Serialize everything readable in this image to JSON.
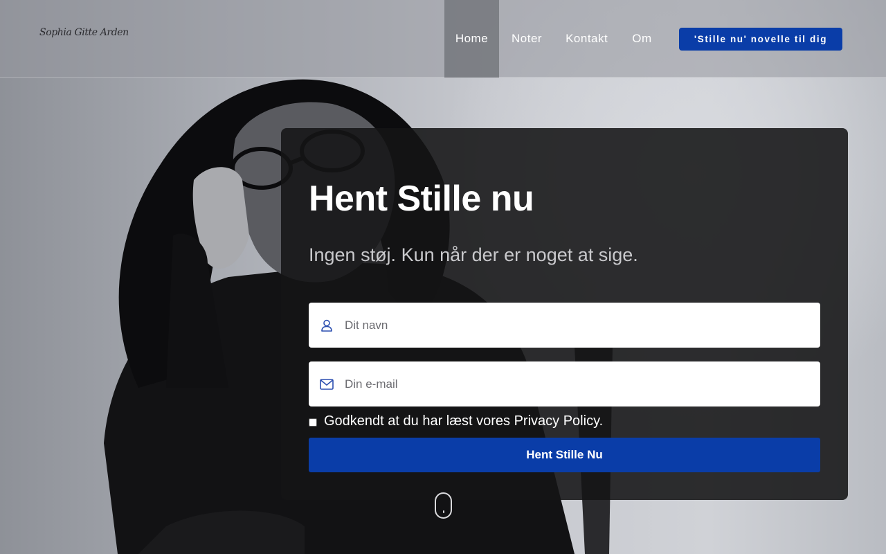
{
  "brand": {
    "logo_text": "Sophia Gitte Arden"
  },
  "nav": {
    "items": [
      {
        "label": "Home",
        "active": true
      },
      {
        "label": "Noter",
        "active": false
      },
      {
        "label": "Kontakt",
        "active": false
      },
      {
        "label": "Om",
        "active": false
      }
    ],
    "cta_label": "'Stille nu' novelle til dig"
  },
  "signup": {
    "title": "Hent Stille nu",
    "subtitle": "Ingen støj. Kun når der er noget at sige.",
    "name_placeholder": "Dit navn",
    "name_icon": "user-icon",
    "email_placeholder": "Din e-mail",
    "email_icon": "envelope-icon",
    "consent_label": "Godkendt at du har læst vores Privacy Policy.",
    "consent_checked": false,
    "submit_label": "Hent Stille Nu"
  },
  "colors": {
    "accent": "#0a3da8",
    "card_bg": "#141416",
    "icon_blue": "#2c4fb0"
  }
}
